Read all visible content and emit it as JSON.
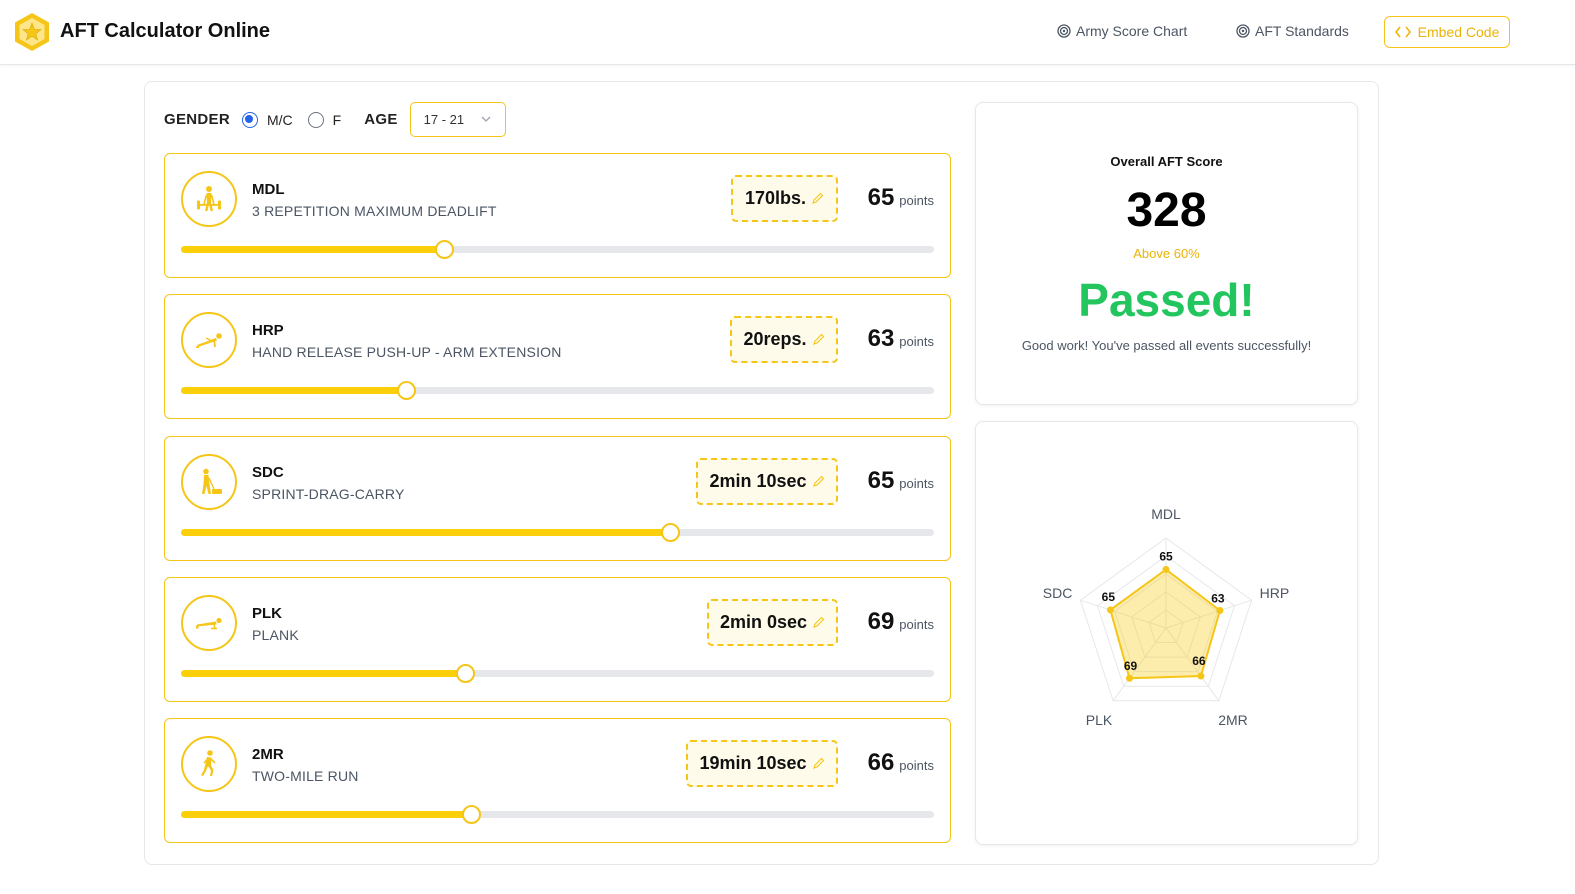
{
  "header": {
    "brand": "AFT Calculator Online",
    "nav": [
      {
        "label": "Army Score Chart",
        "icon": "target-icon"
      },
      {
        "label": "AFT Standards",
        "icon": "target-icon"
      }
    ],
    "embed_label": "Embed Code",
    "accent": "#f5c518"
  },
  "controls": {
    "gender_label": "GENDER",
    "gender_options": [
      "M/C",
      "F"
    ],
    "gender_selected": "M/C",
    "age_label": "AGE",
    "age_value": "17 - 21"
  },
  "events": [
    {
      "code": "MDL",
      "name": "3 REPETITION MAXIMUM DEADLIFT",
      "value": "170lbs.",
      "points": "65",
      "points_unit": "points",
      "icon": "deadlift-icon",
      "slider": 0.35
    },
    {
      "code": "HRP",
      "name": "HAND RELEASE PUSH-UP - ARM EXTENSION",
      "value": "20reps.",
      "points": "63",
      "points_unit": "points",
      "icon": "pushup-icon",
      "slider": 0.3
    },
    {
      "code": "SDC",
      "name": "SPRINT-DRAG-CARRY",
      "value": "2min 10sec",
      "points": "65",
      "points_unit": "points",
      "icon": "sled-drag-icon",
      "slider": 0.65
    },
    {
      "code": "PLK",
      "name": "PLANK",
      "value": "2min 0sec",
      "points": "69",
      "points_unit": "points",
      "icon": "plank-icon",
      "slider": 0.378
    },
    {
      "code": "2MR",
      "name": "TWO-MILE RUN",
      "value": "19min 10sec",
      "points": "66",
      "points_unit": "points",
      "icon": "runner-icon",
      "slider": 0.386
    }
  ],
  "score": {
    "title": "Overall AFT Score",
    "total": "328",
    "percent_text": "Above 60%",
    "status": "Passed!",
    "message": "Good work! You've passed all events successfully!",
    "status_color": "#22c55e"
  },
  "radar": {
    "axes": [
      "MDL",
      "HRP",
      "2MR",
      "PLK",
      "SDC"
    ],
    "values": [
      65,
      63,
      66,
      69,
      65
    ],
    "max": 100
  }
}
